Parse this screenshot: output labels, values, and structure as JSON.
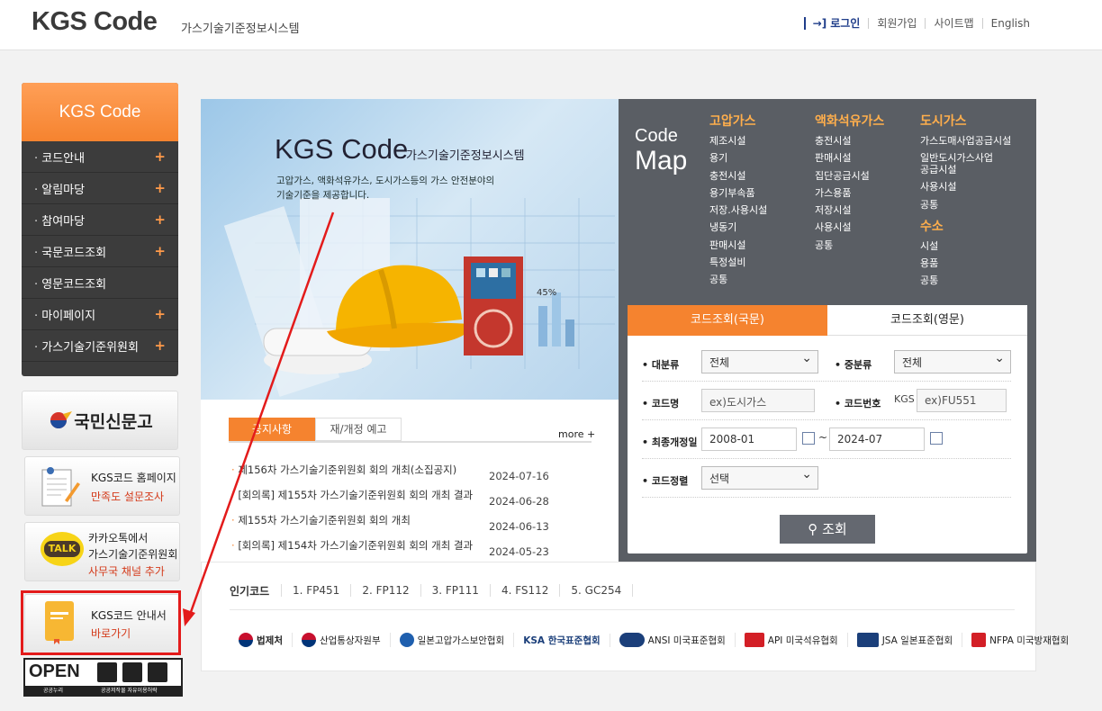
{
  "header": {
    "logo": "KGS Code",
    "logo_sub": "가스기술기준정보시스템",
    "nav": {
      "login": "로그인",
      "join": "회원가입",
      "sitemap": "사이트맵",
      "english": "English"
    }
  },
  "sidebar": {
    "title": "KGS Code",
    "items": [
      {
        "label": "코드안내",
        "plus": "+"
      },
      {
        "label": "알림마당",
        "plus": "+"
      },
      {
        "label": "참여마당",
        "plus": "+"
      },
      {
        "label": "국문코드조회",
        "plus": "+"
      },
      {
        "label": "영문코드조회",
        "plus": ""
      },
      {
        "label": "마이페이지",
        "plus": "+"
      },
      {
        "label": "가스기술기준위원회",
        "plus": "+"
      }
    ]
  },
  "banners": {
    "sinmungo": "국민신문고",
    "survey": {
      "line1": "KGS코드 홈페이지",
      "line2": "만족도 설문조사"
    },
    "kakao": {
      "badge": "TALK",
      "line1": "카카오톡에서",
      "line2": "가스기술기준위원회",
      "line3": "사무국 채널 추가"
    },
    "guide": {
      "line1": "KGS코드 안내서",
      "line2": "바로가기"
    },
    "open": {
      "logo": "OPEN",
      "caption1": "공공누리",
      "caption2": "공공저작물 자유이용허락"
    }
  },
  "hero": {
    "title": "KGS Code",
    "title_sub": "가스기술기준정보시스템",
    "desc_line1": "고압가스, 액화석유가스, 도시가스등의 가스 안전분야의",
    "desc_line2": "기술기준을 제공합니다.",
    "book_percent": "45%"
  },
  "codemap": {
    "logo_line1": "Code",
    "logo_line2": "Map",
    "columns": [
      {
        "heading": "고압가스",
        "items": [
          "제조시설",
          "용기",
          "충전시설",
          "용기부속품",
          "저장.사용시설",
          "냉동기",
          "판매시설",
          "특정설비",
          "공통"
        ]
      },
      {
        "heading": "액화석유가스",
        "items": [
          "충전시설",
          "판매시설",
          "집단공급시설",
          "가스용품",
          "저장시설",
          "사용시설",
          "공통"
        ]
      },
      {
        "heading": "도시가스",
        "items": [
          "가스도매사업공급시설",
          "일반도시가스사업",
          "공급시설",
          "사용시설",
          "공통"
        ]
      },
      {
        "heading": "수소",
        "items": [
          "시설",
          "용품",
          "공통"
        ]
      }
    ]
  },
  "search": {
    "tab_ko": "코드조회(국문)",
    "tab_en": "코드조회(영문)",
    "major_label": "대분류",
    "major_value": "전체",
    "middle_label": "중분류",
    "middle_value": "전체",
    "codename_label": "코드명",
    "codename_placeholder": "ex)도시가스",
    "codeno_label": "코드번호",
    "codeno_prefix": "KGS",
    "codeno_placeholder": "ex)FU551",
    "date_label": "최종개정일",
    "date_from": "2008-01",
    "date_sep": "~",
    "date_to": "2024-07",
    "sort_label": "코드정렬",
    "sort_value": "선택",
    "button": "조회"
  },
  "notice": {
    "tab1": "공지사항",
    "tab2": "재/개정 예고",
    "more": "more +",
    "items": [
      {
        "title": "제156차 가스기술기준위원회 회의 개최(소집공지)",
        "date": "2024-07-16"
      },
      {
        "title": "[회의록] 제155차 가스기술기준위원회 회의 개최 결과",
        "date": "2024-06-28"
      },
      {
        "title": "제155차 가스기술기준위원회 회의 개최",
        "date": "2024-06-13"
      },
      {
        "title": "[회의록] 제154차 가스기술기준위원회 회의 개최 결과",
        "date": "2024-05-23"
      }
    ]
  },
  "popular": {
    "heading": "인기코드",
    "items": [
      "1. FP451",
      "2. FP112",
      "3. FP111",
      "4. FS112",
      "5. GC254"
    ]
  },
  "orgs": [
    "법제처",
    "산업통상자원부",
    "일본고압가스보안협회",
    "KSA 한국표준협회",
    "ANSI 미국표준협회",
    "API 미국석유협회",
    "JSA 일본표준협회",
    "NFPA 미국방재협회"
  ],
  "colors": {
    "accent": "#f5832f",
    "annotation": "#e31b1b",
    "nav_blue": "#1f3d8a"
  }
}
